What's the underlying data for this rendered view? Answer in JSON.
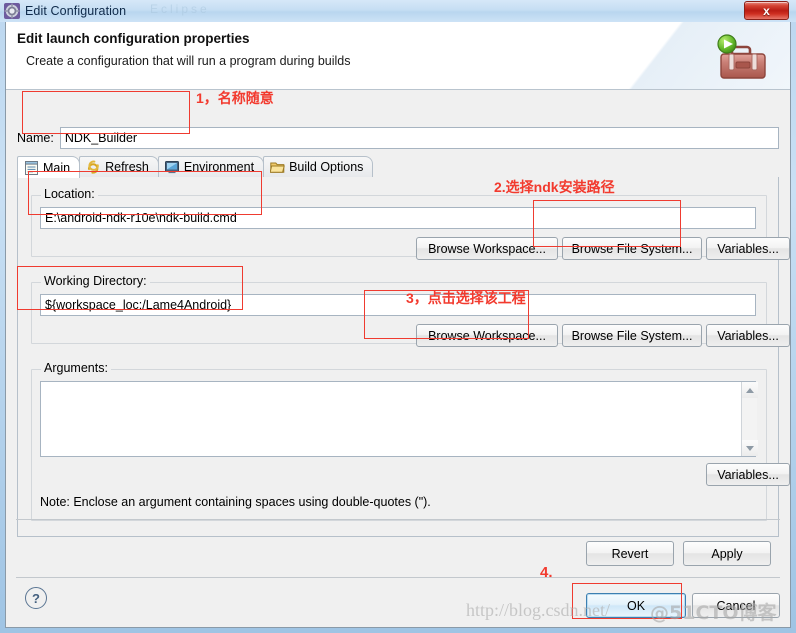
{
  "window": {
    "title": "Edit Configuration",
    "icon": "gear-icon",
    "close_label": "x",
    "ghost_text": "Eclipse"
  },
  "header": {
    "title": "Edit launch configuration properties",
    "subtitle": "Create a configuration that will run a program during builds",
    "icon": "toolbox-run-icon"
  },
  "name_field": {
    "label": "Name:",
    "value": "NDK_Builder",
    "placeholder": ""
  },
  "tabs": [
    {
      "label": "Main",
      "icon": "document-icon",
      "active": true
    },
    {
      "label": "Refresh",
      "icon": "refresh-icon",
      "active": false
    },
    {
      "label": "Environment",
      "icon": "environment-icon",
      "active": false
    },
    {
      "label": "Build Options",
      "icon": "folder-icon",
      "active": false
    }
  ],
  "location": {
    "group_label": "Location:",
    "value": "E:\\android-ndk-r10e\\ndk-build.cmd",
    "buttons": [
      "Browse Workspace...",
      "Browse File System...",
      "Variables..."
    ]
  },
  "working_directory": {
    "group_label": "Working Directory:",
    "value": "${workspace_loc:/Lame4Android}",
    "buttons": [
      "Browse Workspace...",
      "Browse File System...",
      "Variables..."
    ]
  },
  "arguments": {
    "group_label": "Arguments:",
    "value": "",
    "placeholder": "",
    "button": "Variables...",
    "note": "Note: Enclose an argument containing spaces using double-quotes (\")."
  },
  "footer": {
    "revert": "Revert",
    "apply": "Apply",
    "ok": "OK",
    "cancel": "Cancel",
    "help": "?"
  },
  "annotations": [
    {
      "id": 1,
      "text": "1，名称随意"
    },
    {
      "id": 2,
      "text": "2.选择ndk安装路径"
    },
    {
      "id": 3,
      "text": "3，点击选择该工程"
    },
    {
      "id": 4,
      "text": "4."
    }
  ],
  "watermark": {
    "url": "http://blog.csdn.net/",
    "site": "@51CTO博客"
  },
  "colors": {
    "annotation": "#f23a2e",
    "close_button": "#ba1d14",
    "ok_border": "#3c7fb1"
  }
}
